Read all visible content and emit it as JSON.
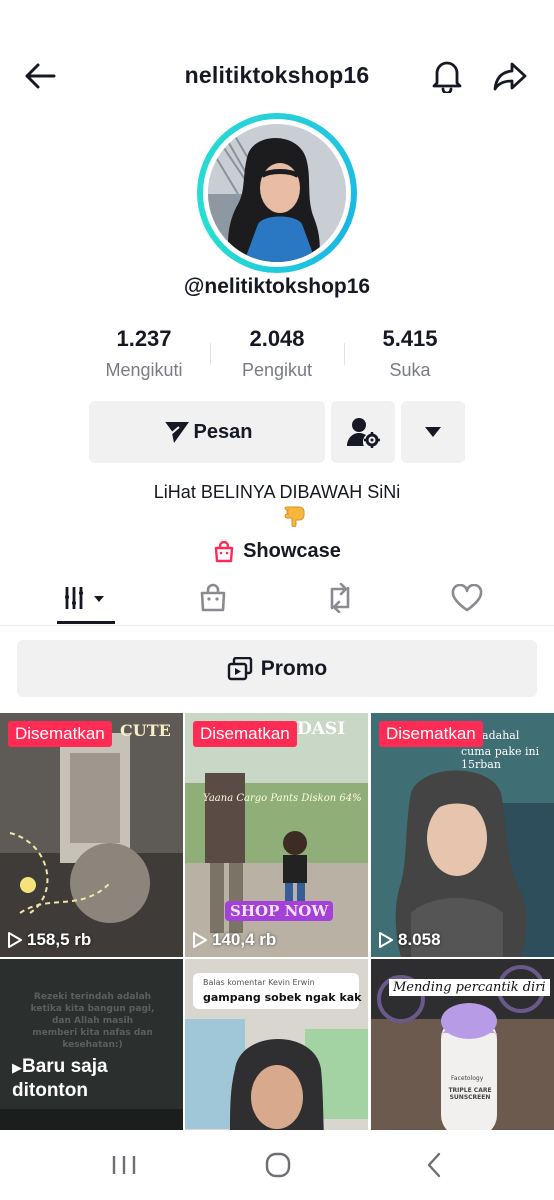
{
  "header": {
    "title": "nelitiktokshop16",
    "back_icon": "arrow-left-icon",
    "notify_icon": "bell-icon",
    "share_icon": "share-arrow-icon"
  },
  "profile": {
    "handle": "@nelitiktokshop16",
    "avatar_ring_color": "#25d1da"
  },
  "stats": [
    {
      "value": "1.237",
      "label": "Mengikuti"
    },
    {
      "value": "2.048",
      "label": "Pengikut"
    },
    {
      "value": "5.415",
      "label": "Suka"
    }
  ],
  "actions": {
    "message_label": "Pesan",
    "message_icon": "send-icon",
    "user_settings_icon": "user-gear-icon",
    "more_icon": "caret-down-icon"
  },
  "bio": {
    "text": "LiHat BELINYA DIBAWAH SiNi",
    "emoji": "pointing-down-emoji"
  },
  "showcase": {
    "label": "Showcase",
    "icon": "shopping-bag-icon",
    "icon_color": "#fe2c55"
  },
  "tabs": [
    {
      "name": "videos",
      "icon": "grid-filter-icon",
      "active": true
    },
    {
      "name": "shop",
      "icon": "shopping-bag-icon",
      "active": false
    },
    {
      "name": "reposts",
      "icon": "repost-icon",
      "active": false
    },
    {
      "name": "liked",
      "icon": "heart-icon",
      "active": false
    }
  ],
  "promo": {
    "label": "Promo",
    "icon": "promo-icon"
  },
  "videos": [
    {
      "pinned": "Disematkan",
      "views": "158,5 rb",
      "overlay": "CUTE"
    },
    {
      "pinned": "Disematkan",
      "views": "140,4 rb",
      "overlay": "Yaana Cargo Pants Diskon 64%",
      "overlay2": "SHOP NOW",
      "overlay3": "DASI"
    },
    {
      "pinned": "Disematkan",
      "views": "8.058",
      "overlay": "padahal",
      "overlay2": "cuma pake ini 15rban"
    },
    {
      "watched": "Baru saja ditonton",
      "overlay": "Rezeki terindah adalah ketika kita bangun pagi, dan Allah masih memberi kita nafas dan kesehatan:)"
    },
    {
      "overlay": "Balas komentar Kevin Erwin",
      "overlay2": "gampang sobek ngak kak"
    },
    {
      "overlay": "Mending percantik diri",
      "overlay2": "TRIPLE CARE SUNSCREEN",
      "overlay3": "Facetology"
    }
  ],
  "navbar": {
    "recent_icon": "recent-apps-icon",
    "home_icon": "home-circle-icon",
    "back_icon": "back-chevron-icon"
  },
  "colors": {
    "accent": "#fe2c55",
    "text": "#161823",
    "muted": "#7a7c85",
    "button_bg": "#f1f1f2"
  }
}
